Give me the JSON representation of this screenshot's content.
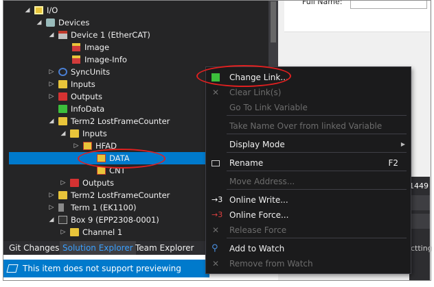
{
  "tree": {
    "rows": [
      {
        "label": "I/O",
        "icon": "io-icon",
        "expander": "◢"
      },
      {
        "label": "Devices",
        "icon": "devices-icon",
        "expander": "◢"
      },
      {
        "label": "Device 1 (EtherCAT)",
        "icon": "device-icon",
        "expander": "◢"
      },
      {
        "label": "Image",
        "icon": "image-icon",
        "expander": ""
      },
      {
        "label": "Image-Info",
        "icon": "image-info-icon",
        "expander": ""
      },
      {
        "label": "SyncUnits",
        "icon": "syncunits-icon",
        "expander": "▷"
      },
      {
        "label": "Inputs",
        "icon": "inputs-folder-icon",
        "expander": "▷"
      },
      {
        "label": "Outputs",
        "icon": "outputs-folder-icon",
        "expander": "▷"
      },
      {
        "label": "InfoData",
        "icon": "infodata-folder-icon",
        "expander": ""
      },
      {
        "label": "Term2 LostFrameCounter",
        "icon": "term-icon",
        "expander": "◢"
      },
      {
        "label": "Inputs",
        "icon": "inputs-folder-icon",
        "expander": "◢"
      },
      {
        "label": "HFAD",
        "icon": "variable-icon",
        "expander": "▷"
      },
      {
        "label": "DATA",
        "icon": "variable-icon",
        "expander": ""
      },
      {
        "label": "CNT",
        "icon": "variable-icon",
        "expander": ""
      },
      {
        "label": "Outputs",
        "icon": "outputs-folder-icon",
        "expander": "▷"
      },
      {
        "label": "Term2 LostFrameCounter",
        "icon": "term-icon",
        "expander": "▷"
      },
      {
        "label": "Term 1 (EK1100)",
        "icon": "coupler-icon",
        "expander": "▷"
      },
      {
        "label": "Box 9 (EPP2308-0001)",
        "icon": "box-icon",
        "expander": "◢"
      },
      {
        "label": "Channel 1",
        "icon": "channel-folder-icon",
        "expander": "▷"
      }
    ]
  },
  "tabs": [
    {
      "label": "Git Changes",
      "active": false
    },
    {
      "label": "Solution Explorer",
      "active": true
    },
    {
      "label": "Team Explorer",
      "active": false
    }
  ],
  "status": {
    "text": "This item does not support previewing"
  },
  "right_panel": {
    "field_label": "Full Name:",
    "value_fragment": "1449",
    "cut_text": "ctting"
  },
  "context_menu": {
    "items": [
      {
        "label": "Change Link...",
        "icon": "change-link-icon",
        "disabled": false,
        "shortcut": ""
      },
      {
        "label": "Clear Link(s)",
        "icon": "clear-link-icon",
        "disabled": true,
        "shortcut": ""
      },
      {
        "label": "Go To Link Variable",
        "icon": "",
        "disabled": true,
        "shortcut": ""
      },
      {
        "label": "Take Name Over from linked Variable",
        "icon": "",
        "disabled": true,
        "shortcut": ""
      },
      {
        "label": "Display Mode",
        "icon": "",
        "disabled": false,
        "shortcut": "",
        "submenu": true
      },
      {
        "label": "Rename",
        "icon": "rename-icon",
        "disabled": false,
        "shortcut": "F2"
      },
      {
        "label": "Move Address...",
        "icon": "",
        "disabled": true,
        "shortcut": ""
      },
      {
        "label": "Online Write...",
        "icon": "online-write-icon",
        "disabled": false,
        "shortcut": ""
      },
      {
        "label": "Online Force...",
        "icon": "online-force-icon",
        "disabled": false,
        "shortcut": ""
      },
      {
        "label": "Release Force",
        "icon": "release-force-icon",
        "disabled": true,
        "shortcut": ""
      },
      {
        "label": "Add to Watch",
        "icon": "add-watch-icon",
        "disabled": false,
        "shortcut": ""
      },
      {
        "label": "Remove from Watch",
        "icon": "remove-watch-icon",
        "disabled": true,
        "shortcut": ""
      }
    ]
  },
  "colors": {
    "accent": "#007acc",
    "annotation": "#e02020",
    "disabled_text": "#6d6d6d"
  }
}
